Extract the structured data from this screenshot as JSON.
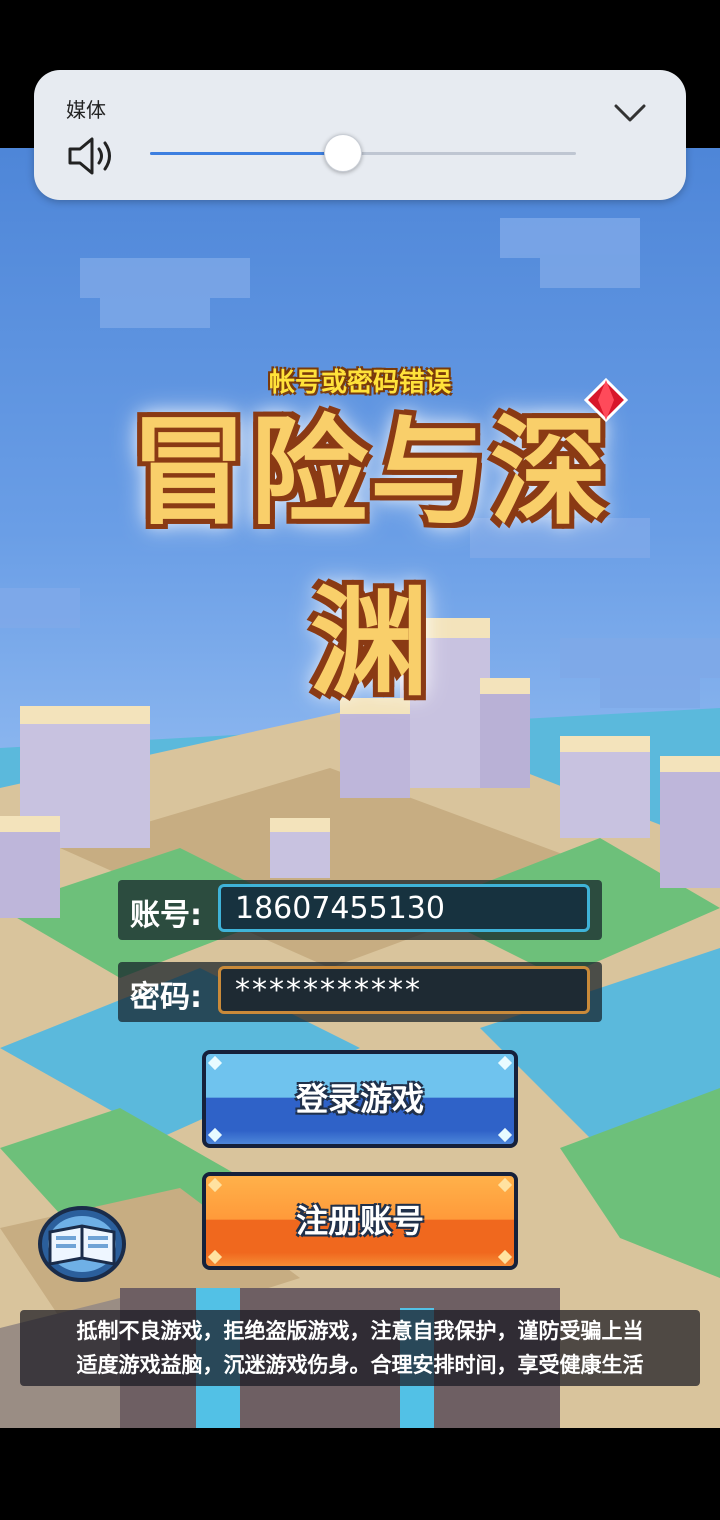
{
  "volume_panel": {
    "title": "媒体",
    "level": 0.45,
    "icons": {
      "speaker": "speaker-icon",
      "collapse": "chevron-down-icon"
    }
  },
  "login": {
    "error_message": "帐号或密码错误",
    "logo_text": "冒险与深渊",
    "account_label": "账号:",
    "account_value": "18607455130",
    "password_label": "密码:",
    "password_value": "***********",
    "login_button": "登录游戏",
    "register_button": "注册账号",
    "guide_icon": "book-icon"
  },
  "notice": {
    "line1": "抵制不良游戏，拒绝盗版游戏，注意自我保护，谨防受骗上当",
    "line2": "适度游戏益脑，沉迷游戏伤身。合理安排时间，享受健康生活"
  },
  "colors": {
    "accent_blue": "#3d7fe0",
    "login_button": "#2f62c8",
    "register_button": "#f0681e",
    "error_text": "#ffe23a"
  }
}
